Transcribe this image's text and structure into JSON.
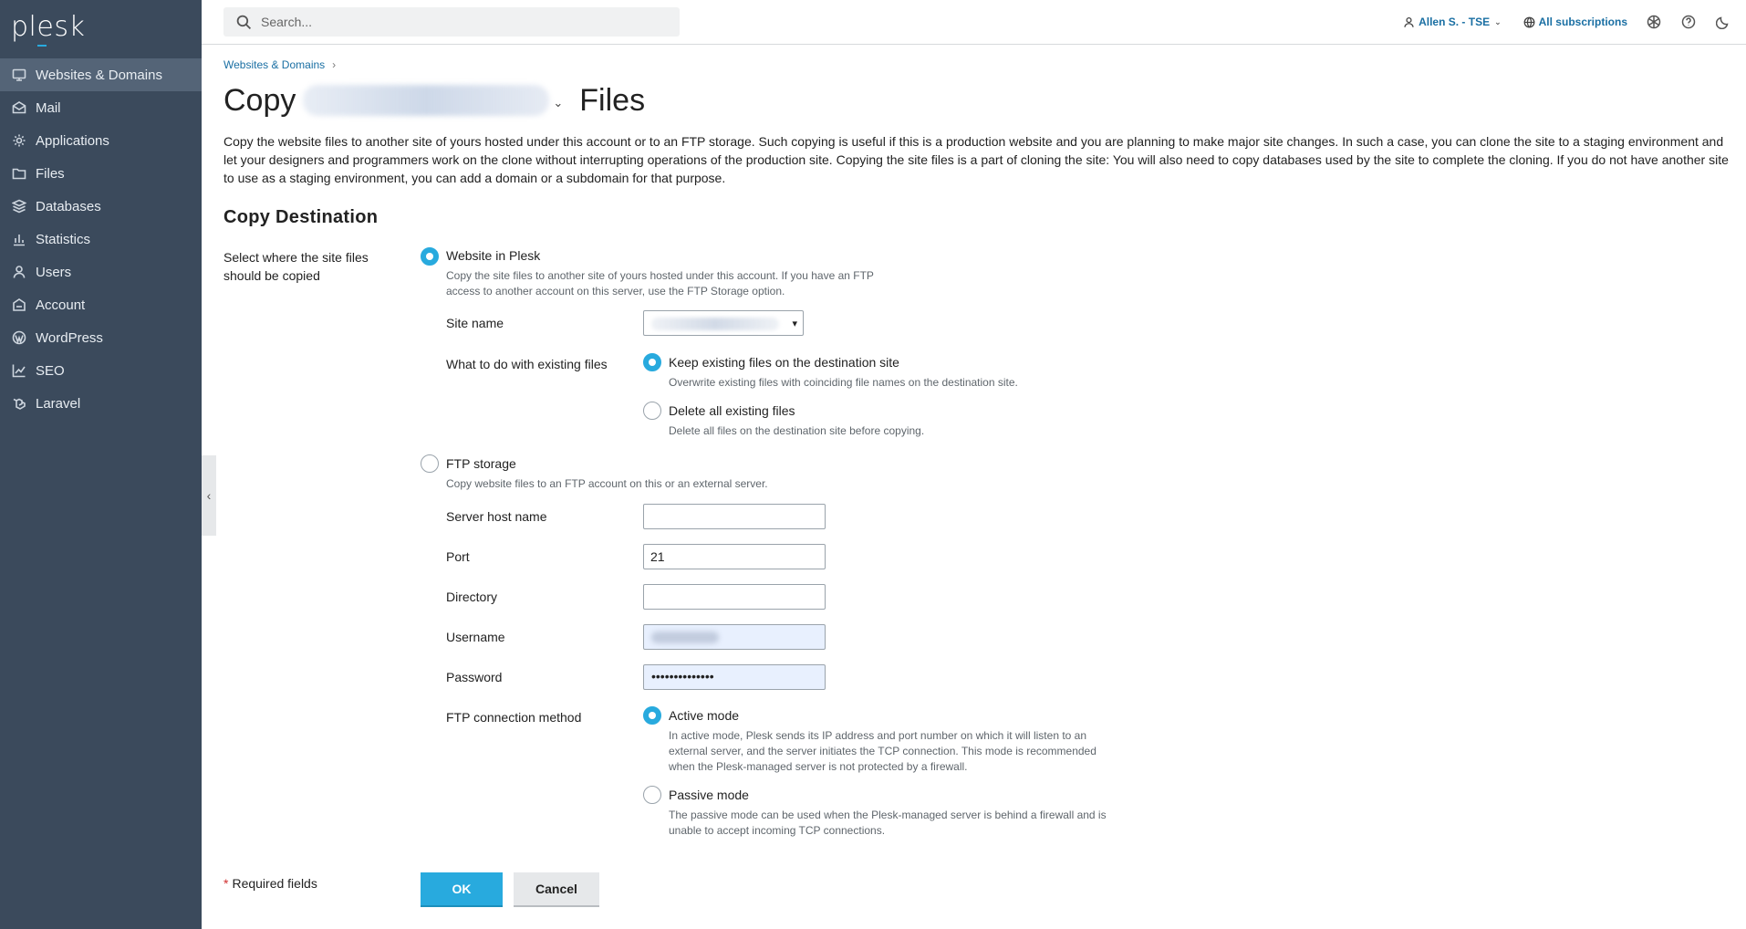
{
  "app": {
    "logo": "plesk"
  },
  "colors": {
    "accent": "#28aade",
    "sidebar": "#3b4a5c",
    "sidebar_active": "#546477",
    "link": "#1a6fa3"
  },
  "sidebar": {
    "items": [
      {
        "label": "Websites & Domains",
        "icon": "monitor-icon"
      },
      {
        "label": "Mail",
        "icon": "mail-icon"
      },
      {
        "label": "Applications",
        "icon": "gear-icon"
      },
      {
        "label": "Files",
        "icon": "folder-icon"
      },
      {
        "label": "Databases",
        "icon": "database-icon"
      },
      {
        "label": "Statistics",
        "icon": "bar-chart-icon"
      },
      {
        "label": "Users",
        "icon": "user-icon"
      },
      {
        "label": "Account",
        "icon": "account-icon"
      },
      {
        "label": "WordPress",
        "icon": "wordpress-icon"
      },
      {
        "label": "SEO",
        "icon": "seo-icon"
      },
      {
        "label": "Laravel",
        "icon": "laravel-icon"
      }
    ]
  },
  "topbar": {
    "search_placeholder": "Search...",
    "user": "Allen S. - TSE",
    "subscriptions": "All subscriptions"
  },
  "breadcrumb": {
    "item": "Websites & Domains"
  },
  "page": {
    "title_prefix": "Copy",
    "title_suffix": "Files",
    "intro": "Copy the website files to another site of yours hosted under this account or to an FTP storage. Such copying is useful if this is a production website and you are planning to make major site changes. In such a case, you can clone the site to a staging environment and let your designers and programmers work on the clone without interrupting operations of the production site. Copying the site files is a part of cloning the site: You will also need to copy databases used by the site to complete the cloning. If you do not have another site to use as a staging environment, you can add a domain or a subdomain for that purpose.",
    "section_title": "Copy Destination",
    "destination_label": "Select where the site files should be copied"
  },
  "form": {
    "website": {
      "label": "Website in Plesk",
      "hint": "Copy the site files to another site of yours hosted under this account. If you have an FTP access to another account on this server, use the FTP Storage option.",
      "site_name_label": "Site name",
      "existing_label": "What to do with existing files",
      "keep_label": "Keep existing files on the destination site",
      "keep_hint": "Overwrite existing files with coinciding file names on the destination site.",
      "delete_label": "Delete all existing files",
      "delete_hint": "Delete all files on the destination site before copying."
    },
    "ftp": {
      "label": "FTP storage",
      "hint": "Copy website files to an FTP account on this or an external server.",
      "host_label": "Server host name",
      "host_value": "",
      "port_label": "Port",
      "port_value": "21",
      "dir_label": "Directory",
      "dir_value": "",
      "user_label": "Username",
      "pass_label": "Password",
      "pass_value": "••••••••••••••",
      "method_label": "FTP connection method",
      "active_label": "Active mode",
      "active_hint": "In active mode, Plesk sends its IP address and port number on which it will listen to an external server, and the server initiates the TCP connection. This mode is recommended when the Plesk-managed server is not protected by a firewall.",
      "passive_label": "Passive mode",
      "passive_hint": "The passive mode can be used when the Plesk-managed server is behind a firewall and is unable to accept incoming TCP connections."
    },
    "required": "Required fields",
    "ok": "OK",
    "cancel": "Cancel"
  }
}
